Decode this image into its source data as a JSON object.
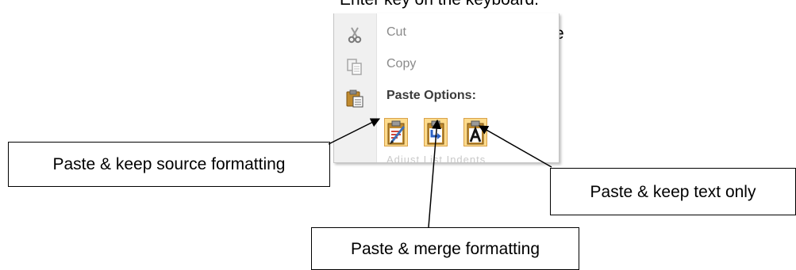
{
  "document": {
    "partial_line": "Enter key on the keyboard.",
    "partial_letter": "e"
  },
  "context_menu": {
    "items": [
      {
        "label": "Cut",
        "icon": "scissors-icon",
        "enabled": false
      },
      {
        "label": "Copy",
        "icon": "copy-icon",
        "enabled": false
      },
      {
        "label": "Paste Options:",
        "icon": "clipboard-icon",
        "heading": true
      }
    ],
    "paste_buttons": [
      {
        "name": "keep-source-formatting",
        "icon": "paste-keep-source-icon"
      },
      {
        "name": "merge-formatting",
        "icon": "paste-merge-icon"
      },
      {
        "name": "keep-text-only",
        "icon": "paste-text-only-icon"
      }
    ],
    "next_item_partial": "Adjust List Indents"
  },
  "callouts": {
    "keep_source": "Paste & keep source formatting",
    "merge": "Paste & merge formatting",
    "text_only": "Paste & keep text only"
  }
}
